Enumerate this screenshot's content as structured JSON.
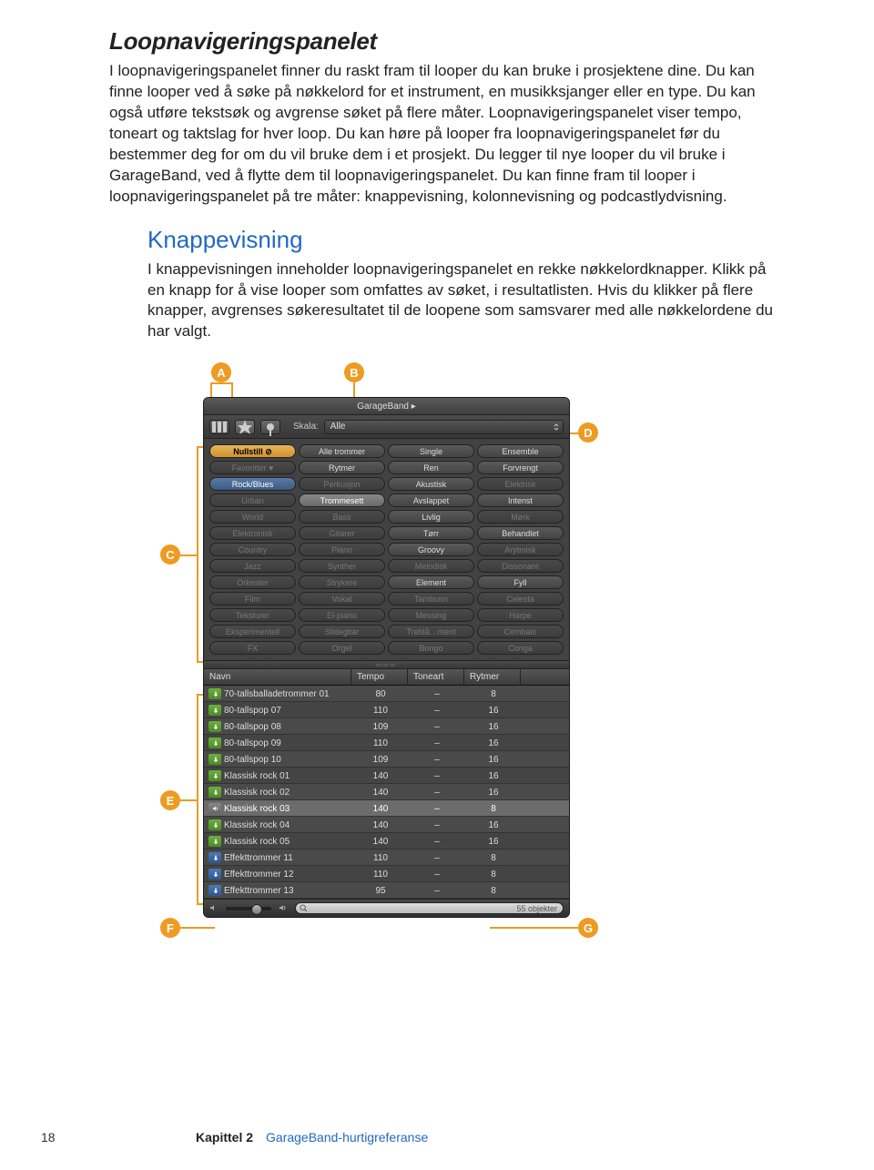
{
  "title": "Loopnavigeringspanelet",
  "body1": "I loopnavigeringspanelet finner du raskt fram til looper du kan bruke i prosjektene dine. Du kan finne looper ved å søke på nøkkelord for et instrument, en musikksjanger eller en type. Du kan også utføre tekstsøk og avgrense søket på flere måter. Loopnavigeringspanelet viser tempo, toneart og taktslag for hver loop. Du kan høre på looper fra loopnavigeringspanelet før du bestemmer deg for om du vil bruke dem i et prosjekt. Du legger til nye looper du vil bruke i GarageBand, ved å flytte dem til loopnavigeringspanelet. Du kan finne fram til looper i loopnavigeringspanelet på tre måter: knappevisning, kolonnevisning og podcastlydvisning.",
  "subtitle": "Knappevisning",
  "body2": "I knappevisningen inneholder loopnavigeringspanelet en rekke nøkkelordknapper. Klikk på en knapp for å vise looper som omfattes av søket, i resultatlisten. Hvis du klikker på flere knapper, avgrenses søkeresultatet til de loopene som samsvarer med alle nøkkelordene du har valgt.",
  "callouts": {
    "a": "A",
    "b": "B",
    "c": "C",
    "d": "D",
    "e": "E",
    "f": "F",
    "g": "G"
  },
  "panel": {
    "title": "GarageBand ▸",
    "skala_label": "Skala:",
    "skala_value": "Alle",
    "keywords": [
      {
        "t": "Nullstill ⊘",
        "cls": "reset"
      },
      {
        "t": "Alle trommer",
        "cls": ""
      },
      {
        "t": "Single",
        "cls": ""
      },
      {
        "t": "Ensemble",
        "cls": ""
      },
      {
        "t": "Favoritter ♥",
        "cls": "dim"
      },
      {
        "t": "Rytmer",
        "cls": ""
      },
      {
        "t": "Ren",
        "cls": ""
      },
      {
        "t": "Forvrengt",
        "cls": ""
      },
      {
        "t": "Rock/Blues",
        "cls": "sel-blue"
      },
      {
        "t": "Perkusjon",
        "cls": "dim"
      },
      {
        "t": "Akustisk",
        "cls": ""
      },
      {
        "t": "Elektrisk",
        "cls": "dim"
      },
      {
        "t": "Urban",
        "cls": "dim"
      },
      {
        "t": "Trommesett",
        "cls": "sel-gray"
      },
      {
        "t": "Avslappet",
        "cls": ""
      },
      {
        "t": "Intenst",
        "cls": ""
      },
      {
        "t": "World",
        "cls": "dim"
      },
      {
        "t": "Bass",
        "cls": "dim"
      },
      {
        "t": "Livlig",
        "cls": ""
      },
      {
        "t": "Mørk",
        "cls": "dim"
      },
      {
        "t": "Elektronisk",
        "cls": "dim"
      },
      {
        "t": "Gitarer",
        "cls": "dim"
      },
      {
        "t": "Tørr",
        "cls": ""
      },
      {
        "t": "Behandlet",
        "cls": ""
      },
      {
        "t": "Country",
        "cls": "dim"
      },
      {
        "t": "Piano",
        "cls": "dim"
      },
      {
        "t": "Groovy",
        "cls": ""
      },
      {
        "t": "Arytmisk",
        "cls": "dim"
      },
      {
        "t": "Jazz",
        "cls": "dim"
      },
      {
        "t": "Synther",
        "cls": "dim"
      },
      {
        "t": "Melodisk",
        "cls": "dim"
      },
      {
        "t": "Dissonant",
        "cls": "dim"
      },
      {
        "t": "Orkester",
        "cls": "dim"
      },
      {
        "t": "Strykere",
        "cls": "dim"
      },
      {
        "t": "Element",
        "cls": ""
      },
      {
        "t": "Fyll",
        "cls": ""
      },
      {
        "t": "Film",
        "cls": "dim"
      },
      {
        "t": "Vokal",
        "cls": "dim"
      },
      {
        "t": "Tamburin",
        "cls": "dim"
      },
      {
        "t": "Celesta",
        "cls": "dim"
      },
      {
        "t": "Teksturer",
        "cls": "dim"
      },
      {
        "t": "El-piano",
        "cls": "dim"
      },
      {
        "t": "Messing",
        "cls": "dim"
      },
      {
        "t": "Harpe",
        "cls": "dim"
      },
      {
        "t": "Eksperimentell",
        "cls": "dim"
      },
      {
        "t": "Slidegitar",
        "cls": "dim"
      },
      {
        "t": "Treblå…ment",
        "cls": "dim"
      },
      {
        "t": "Cembalo",
        "cls": "dim"
      },
      {
        "t": "FX",
        "cls": "dim"
      },
      {
        "t": "Orgel",
        "cls": "dim"
      },
      {
        "t": "Bongo",
        "cls": "dim"
      },
      {
        "t": "Conga",
        "cls": "dim"
      }
    ],
    "cols": {
      "name": "Navn",
      "tempo": "Tempo",
      "key": "Toneart",
      "beats": "Rytmer"
    },
    "rows": [
      {
        "icon": "green",
        "name": "70-tallsballadetrommer 01",
        "tempo": "80",
        "key": "–",
        "beats": "8"
      },
      {
        "icon": "green",
        "name": "80-tallspop 07",
        "tempo": "110",
        "key": "–",
        "beats": "16"
      },
      {
        "icon": "green",
        "name": "80-tallspop 08",
        "tempo": "109",
        "key": "–",
        "beats": "16"
      },
      {
        "icon": "green",
        "name": "80-tallspop 09",
        "tempo": "110",
        "key": "–",
        "beats": "16"
      },
      {
        "icon": "green",
        "name": "80-tallspop 10",
        "tempo": "109",
        "key": "–",
        "beats": "16"
      },
      {
        "icon": "green",
        "name": "Klassisk rock 01",
        "tempo": "140",
        "key": "–",
        "beats": "16"
      },
      {
        "icon": "green",
        "name": "Klassisk rock 02",
        "tempo": "140",
        "key": "–",
        "beats": "16"
      },
      {
        "icon": "speaker",
        "name": "Klassisk rock 03",
        "tempo": "140",
        "key": "–",
        "beats": "8",
        "sel": true
      },
      {
        "icon": "green",
        "name": "Klassisk rock 04",
        "tempo": "140",
        "key": "–",
        "beats": "16"
      },
      {
        "icon": "green",
        "name": "Klassisk rock 05",
        "tempo": "140",
        "key": "–",
        "beats": "16"
      },
      {
        "icon": "blue",
        "name": "Effekttrommer 11",
        "tempo": "110",
        "key": "–",
        "beats": "8"
      },
      {
        "icon": "blue",
        "name": "Effekttrommer 12",
        "tempo": "110",
        "key": "–",
        "beats": "8"
      },
      {
        "icon": "blue",
        "name": "Effekttrommer 13",
        "tempo": "95",
        "key": "–",
        "beats": "8"
      }
    ],
    "footer_count": "55 objekter"
  },
  "footer": {
    "page": "18",
    "chapter": "Kapittel 2",
    "ref": "GarageBand-hurtigreferanse"
  }
}
